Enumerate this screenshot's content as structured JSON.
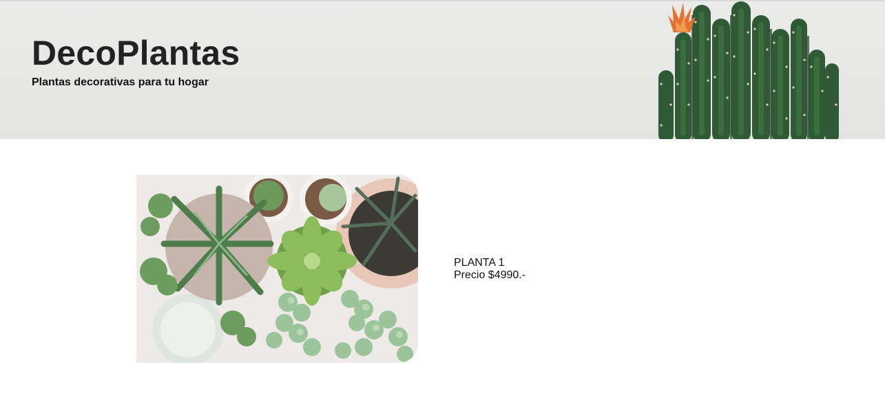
{
  "header": {
    "title": "DecoPlantas",
    "subtitle": "Plantas decorativas para tu hogar",
    "image_icon": "cactus-photo"
  },
  "products": [
    {
      "name": "PLANTA 1",
      "price": "Precio $4990.-",
      "image_icon": "succulents-photo"
    }
  ]
}
